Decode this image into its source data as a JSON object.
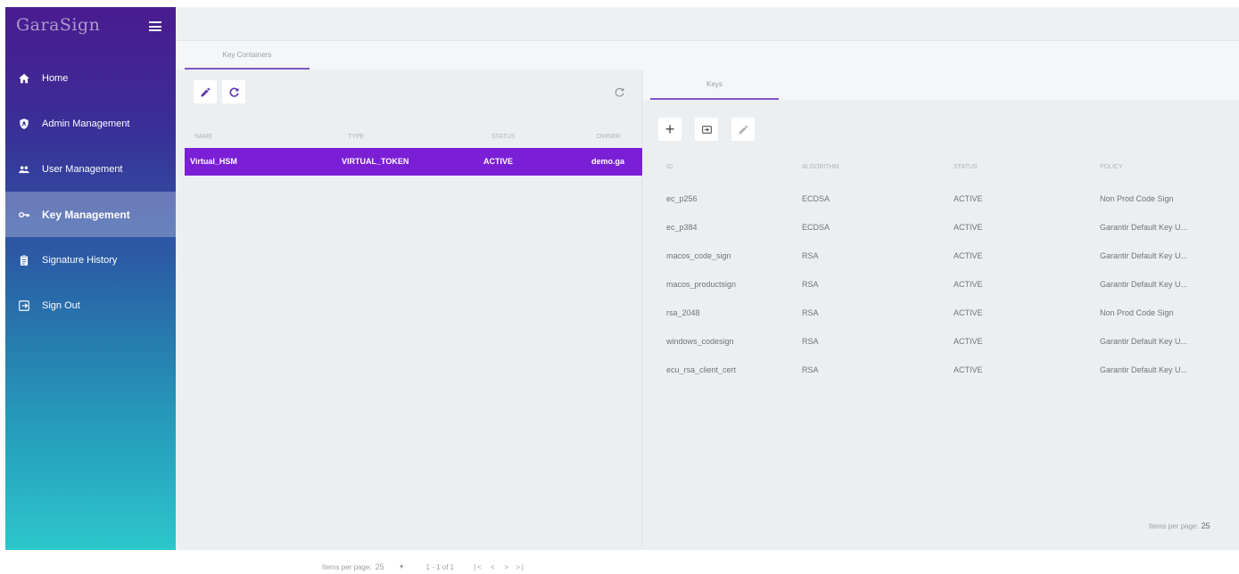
{
  "brand": {
    "name": "GaraSign"
  },
  "sidebar": {
    "items": [
      {
        "label": "Home",
        "icon": "home-icon"
      },
      {
        "label": "Admin Management",
        "icon": "shield-icon"
      },
      {
        "label": "User Management",
        "icon": "users-icon"
      },
      {
        "label": "Key Management",
        "icon": "key-icon",
        "active": true
      },
      {
        "label": "Signature History",
        "icon": "clipboard-icon"
      },
      {
        "label": "Sign Out",
        "icon": "sign-out-icon"
      }
    ]
  },
  "tabs": {
    "key_containers": "Key Containers",
    "keys": "Keys"
  },
  "containers": {
    "columns": [
      "NAME",
      "TYPE",
      "STATUS",
      "OWNER"
    ],
    "rows": [
      {
        "name": "Virtual_HSM",
        "type": "VIRTUAL_TOKEN",
        "status": "ACTIVE",
        "owner": "demo.ga"
      }
    ],
    "paginator": {
      "items_per_page_label": "Items per page:",
      "items_per_page_value": "25",
      "range": "1 - 1 of 1"
    }
  },
  "keys": {
    "columns": [
      "ID",
      "ALGORITHM",
      "STATUS",
      "POLICY"
    ],
    "rows": [
      {
        "id": "ec_p256",
        "algorithm": "ECDSA",
        "status": "ACTIVE",
        "policy": "Non Prod Code Sign"
      },
      {
        "id": "ec_p384",
        "algorithm": "ECDSA",
        "status": "ACTIVE",
        "policy": "Garantir Default Key U..."
      },
      {
        "id": "macos_code_sign",
        "algorithm": "RSA",
        "status": "ACTIVE",
        "policy": "Garantir Default Key U..."
      },
      {
        "id": "macos_productsign",
        "algorithm": "RSA",
        "status": "ACTIVE",
        "policy": "Garantir Default Key U..."
      },
      {
        "id": "rsa_2048",
        "algorithm": "RSA",
        "status": "ACTIVE",
        "policy": "Non Prod Code Sign"
      },
      {
        "id": "windows_codesign",
        "algorithm": "RSA",
        "status": "ACTIVE",
        "policy": "Garantir Default Key U..."
      },
      {
        "id": "ecu_rsa_client_cert",
        "algorithm": "RSA",
        "status": "ACTIVE",
        "policy": "Garantir Default Key U..."
      }
    ],
    "paginator": {
      "items_per_page_label": "Items per page:",
      "items_per_page_value": "25"
    }
  },
  "colors": {
    "accent": "#7b1fd6",
    "icon_purple": "#5e35b1"
  }
}
